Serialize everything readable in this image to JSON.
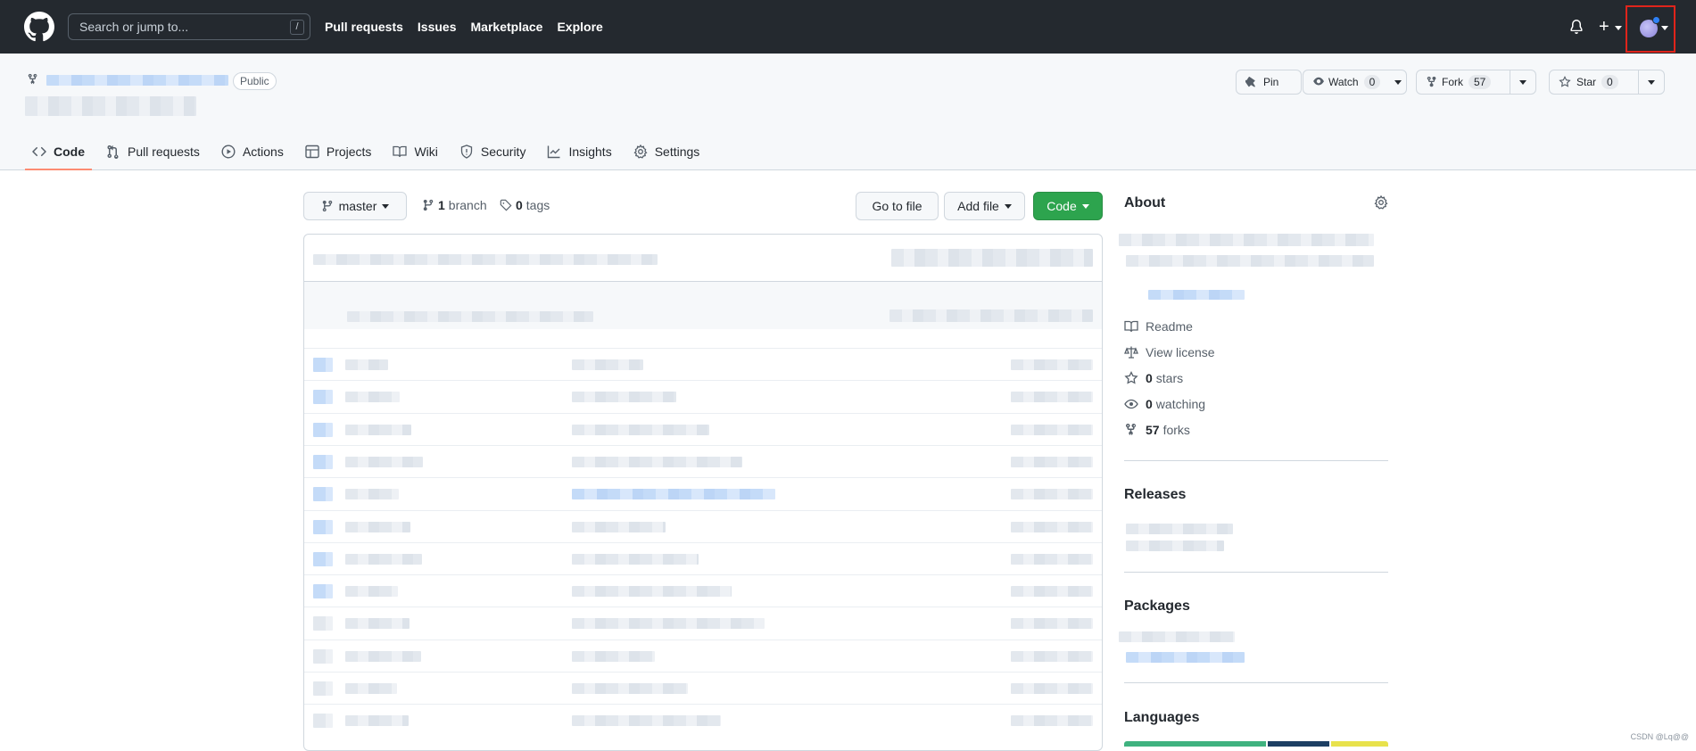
{
  "topbar": {
    "search_placeholder": "Search or jump to...",
    "search_shortcut": "/",
    "nav": [
      "Pull requests",
      "Issues",
      "Marketplace",
      "Explore"
    ],
    "plus": "+"
  },
  "repo": {
    "visibility": "Public",
    "pin_label": "Pin",
    "watch_label": "Watch",
    "watch_count": "0",
    "fork_label": "Fork",
    "fork_count": "57",
    "star_label": "Star",
    "star_count": "0"
  },
  "tabs": [
    {
      "label": "Code",
      "icon": "code-icon"
    },
    {
      "label": "Pull requests",
      "icon": "pull-request-icon"
    },
    {
      "label": "Actions",
      "icon": "play-icon"
    },
    {
      "label": "Projects",
      "icon": "table-icon"
    },
    {
      "label": "Wiki",
      "icon": "book-icon"
    },
    {
      "label": "Security",
      "icon": "shield-icon"
    },
    {
      "label": "Insights",
      "icon": "graph-icon"
    },
    {
      "label": "Settings",
      "icon": "gear-icon"
    }
  ],
  "main": {
    "branch": "master",
    "branch_count": "1",
    "branch_word": "branch",
    "tag_count": "0",
    "tag_word": "tags",
    "goto_file": "Go to file",
    "add_file": "Add file",
    "code_btn": "Code"
  },
  "sidebar": {
    "about": "About",
    "readme": "Readme",
    "license": "View license",
    "stars_count": "0",
    "stars_word": "stars",
    "watching_count": "0",
    "watching_word": "watching",
    "forks_count": "57",
    "forks_word": "forks",
    "releases": "Releases",
    "packages": "Packages",
    "languages": "Languages"
  },
  "colors": {
    "header_bg": "#24292f",
    "green": "#2da44e",
    "active_tab_underline": "#fd8c73",
    "highlight_box": "#e0241b",
    "lang_bar": [
      "#3fb27f",
      "#1d3f63",
      "#e8e24c"
    ]
  },
  "watermark": "CSDN @Lq@@"
}
